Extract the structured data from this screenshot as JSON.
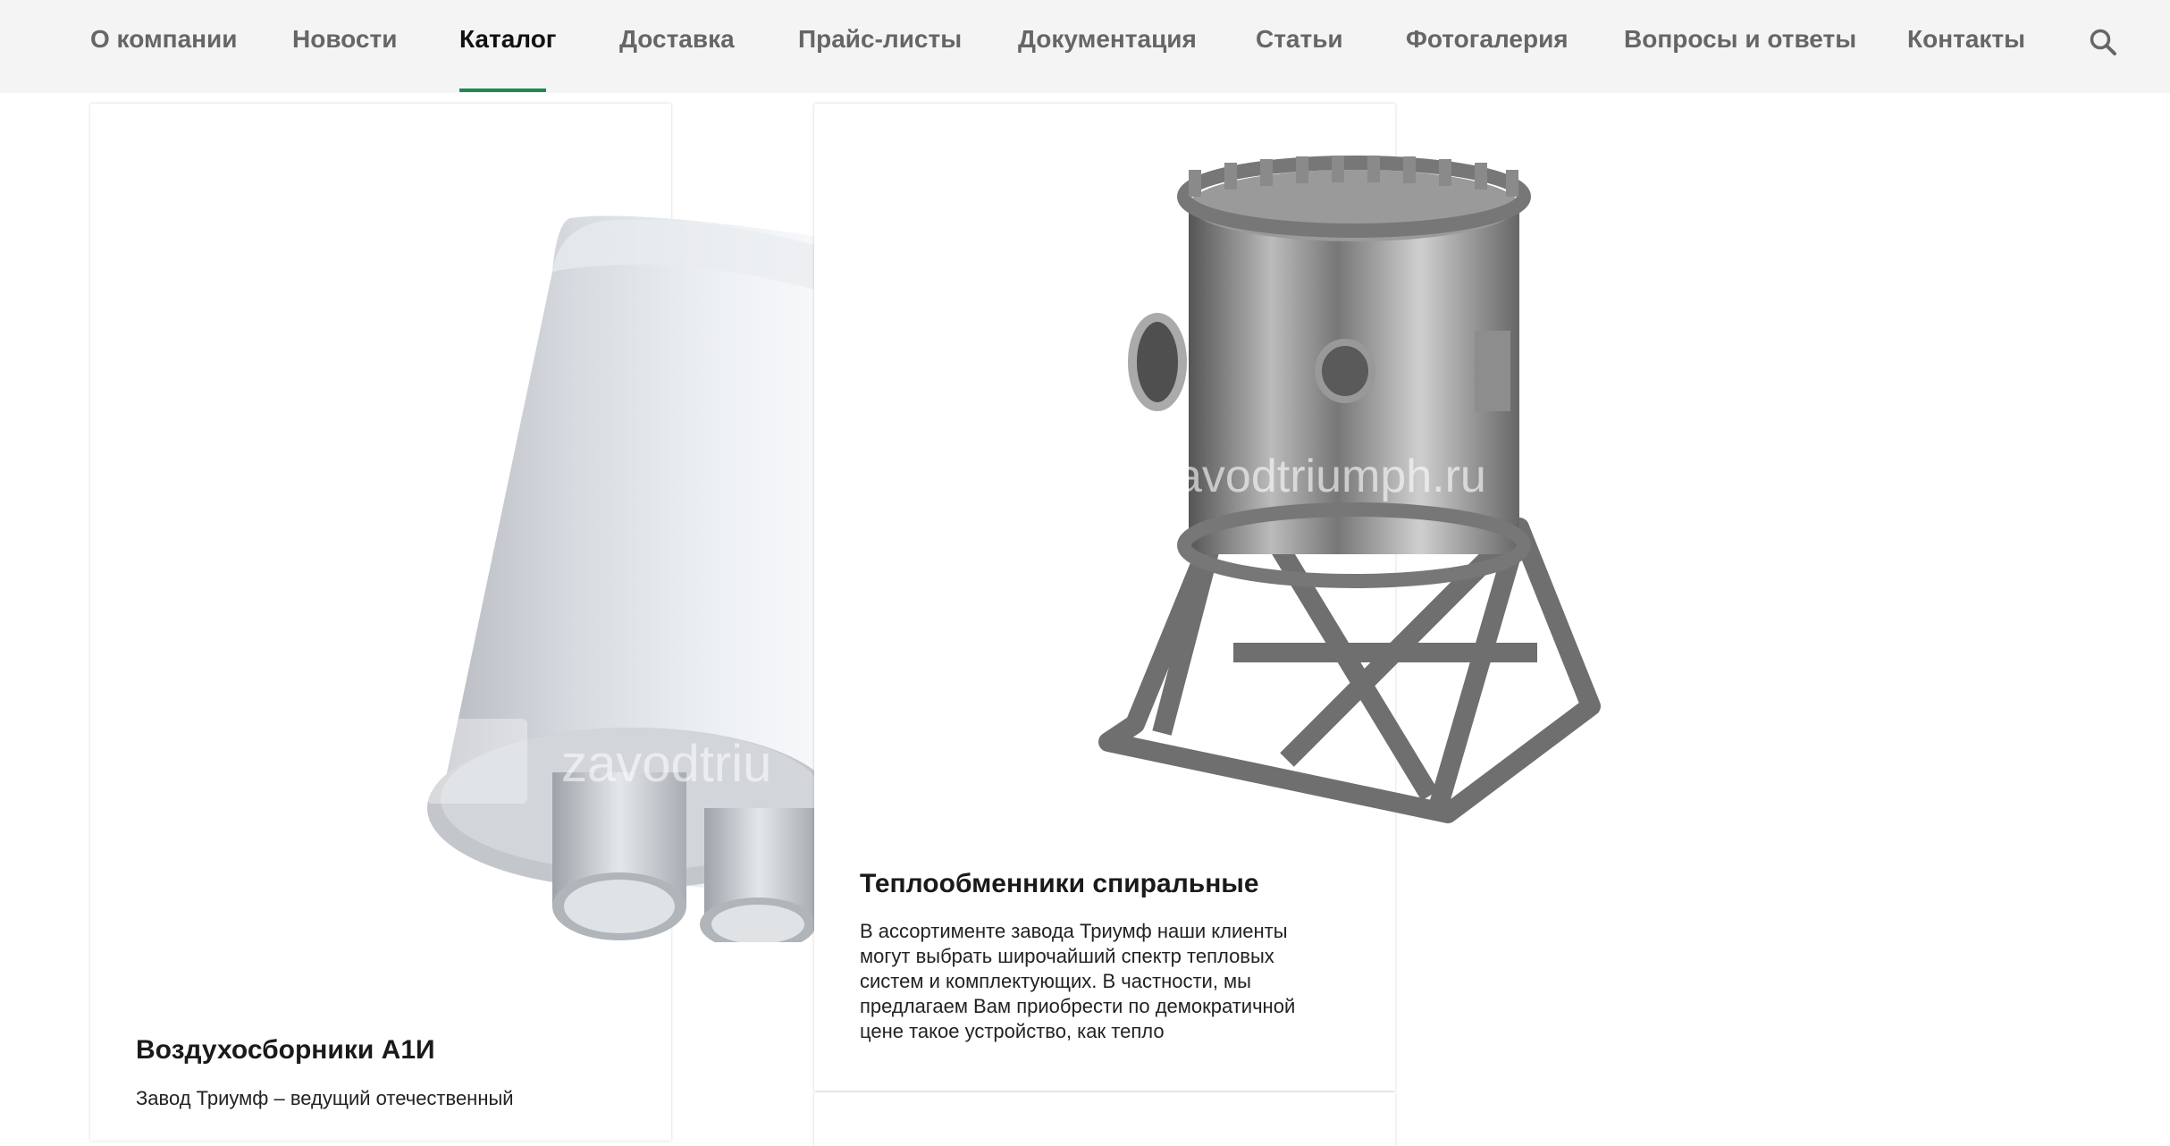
{
  "nav": {
    "items": [
      {
        "label": "О компании"
      },
      {
        "label": "Новости"
      },
      {
        "label": "Каталог",
        "active": true
      },
      {
        "label": "Доставка"
      },
      {
        "label": "Прайс-листы"
      },
      {
        "label": "Документация"
      },
      {
        "label": "Статьи"
      },
      {
        "label": "Фотогалерия"
      },
      {
        "label": "Вопросы и ответы"
      },
      {
        "label": "Контакты"
      }
    ],
    "search_icon": "search-icon",
    "accent_color": "#1c8a52"
  },
  "cards": [
    {
      "title": "Воздухосборники А1И",
      "text": "Завод Триумф – ведущий отечественный",
      "watermark": "zavodtriu"
    },
    {
      "title": "Теплообменники спиральные",
      "text": "В ассортименте завода Триумф наши клиенты могут выбрать широчайший спектр тепловых систем и комплектующих. В частности, мы предлагаем Вам приобрести по демократичной цене такое устройство, как тепло",
      "watermark": "zavodtriumph.ru"
    }
  ]
}
